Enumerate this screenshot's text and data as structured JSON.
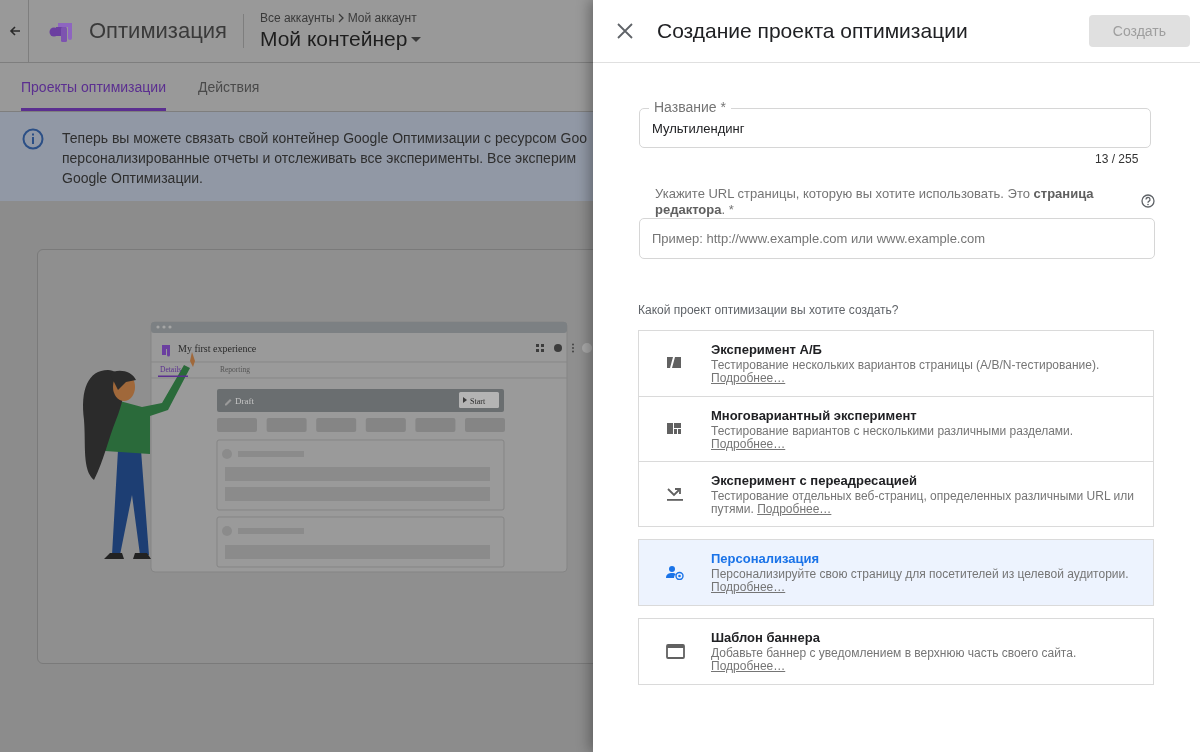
{
  "back_page": {
    "header": {
      "app_name": "Оптимизация",
      "breadcrumb": [
        "Все аккаунты",
        "Мой аккаунт"
      ],
      "container": "Мой контейнер"
    },
    "tabs": [
      {
        "label": "Проекты оптимизации",
        "selected": true
      },
      {
        "label": "Действия",
        "selected": false
      }
    ],
    "notice": {
      "lines": [
        "Теперь вы можете связать свой контейнер Google Оптимизации с ресурсом Goo",
        "персонализированные отчеты и отслеживать все эксперименты. Все эксперим",
        "Google Оптимизации."
      ]
    },
    "illustration": {
      "window_title": "My first experience",
      "tabs": [
        {
          "label": "Details",
          "selected": true
        },
        {
          "label": "Reporting",
          "selected": false
        }
      ],
      "status": "Draft",
      "button": "Start"
    }
  },
  "panel": {
    "title": "Создание проекта оптимизации",
    "create_button": {
      "label": "Создать",
      "disabled": true
    },
    "name_field": {
      "label": "Название *",
      "value": "Мультилендинг",
      "counter": "13 / 255"
    },
    "url_field": {
      "label": "Укажите URL страницы, которую вы хотите использовать. Это **страница редактора**. *",
      "placeholder": "Пример: http://www.example.com или www.example.com"
    },
    "question": "Какой проект оптимизации вы хотите создать?",
    "option_groups": [
      {
        "options": [
          {
            "kind": "ab",
            "title": "Эксперимент А/Б",
            "description": "Тестирование нескольких вариантов страницы (A/B/N-тестирование).",
            "link": "Подробнее…",
            "selected": false
          },
          {
            "kind": "multivariate",
            "title": "Многовариантный эксперимент",
            "description": "Тестирование вариантов с несколькими различными разделами.",
            "link": "Подробнее…",
            "selected": false
          },
          {
            "kind": "redirect",
            "title": "Эксперимент с переадресацией",
            "description": "Тестирование отдельных веб-страниц, определенных различными URL или путями.",
            "link": "Подробнее…",
            "selected": false
          }
        ]
      },
      {
        "options": [
          {
            "kind": "personalization",
            "title": "Персонализация",
            "description": "Персонализируйте свою страницу для посетителей из целевой аудитории.",
            "link": "Подробнее…",
            "selected": true
          }
        ]
      },
      {
        "options": [
          {
            "kind": "banner",
            "title": "Шаблон баннера",
            "description": "Добавьте баннер с уведомлением в верхнюю часть своего сайта.",
            "link": "Подробнее…",
            "selected": false
          }
        ]
      }
    ]
  }
}
